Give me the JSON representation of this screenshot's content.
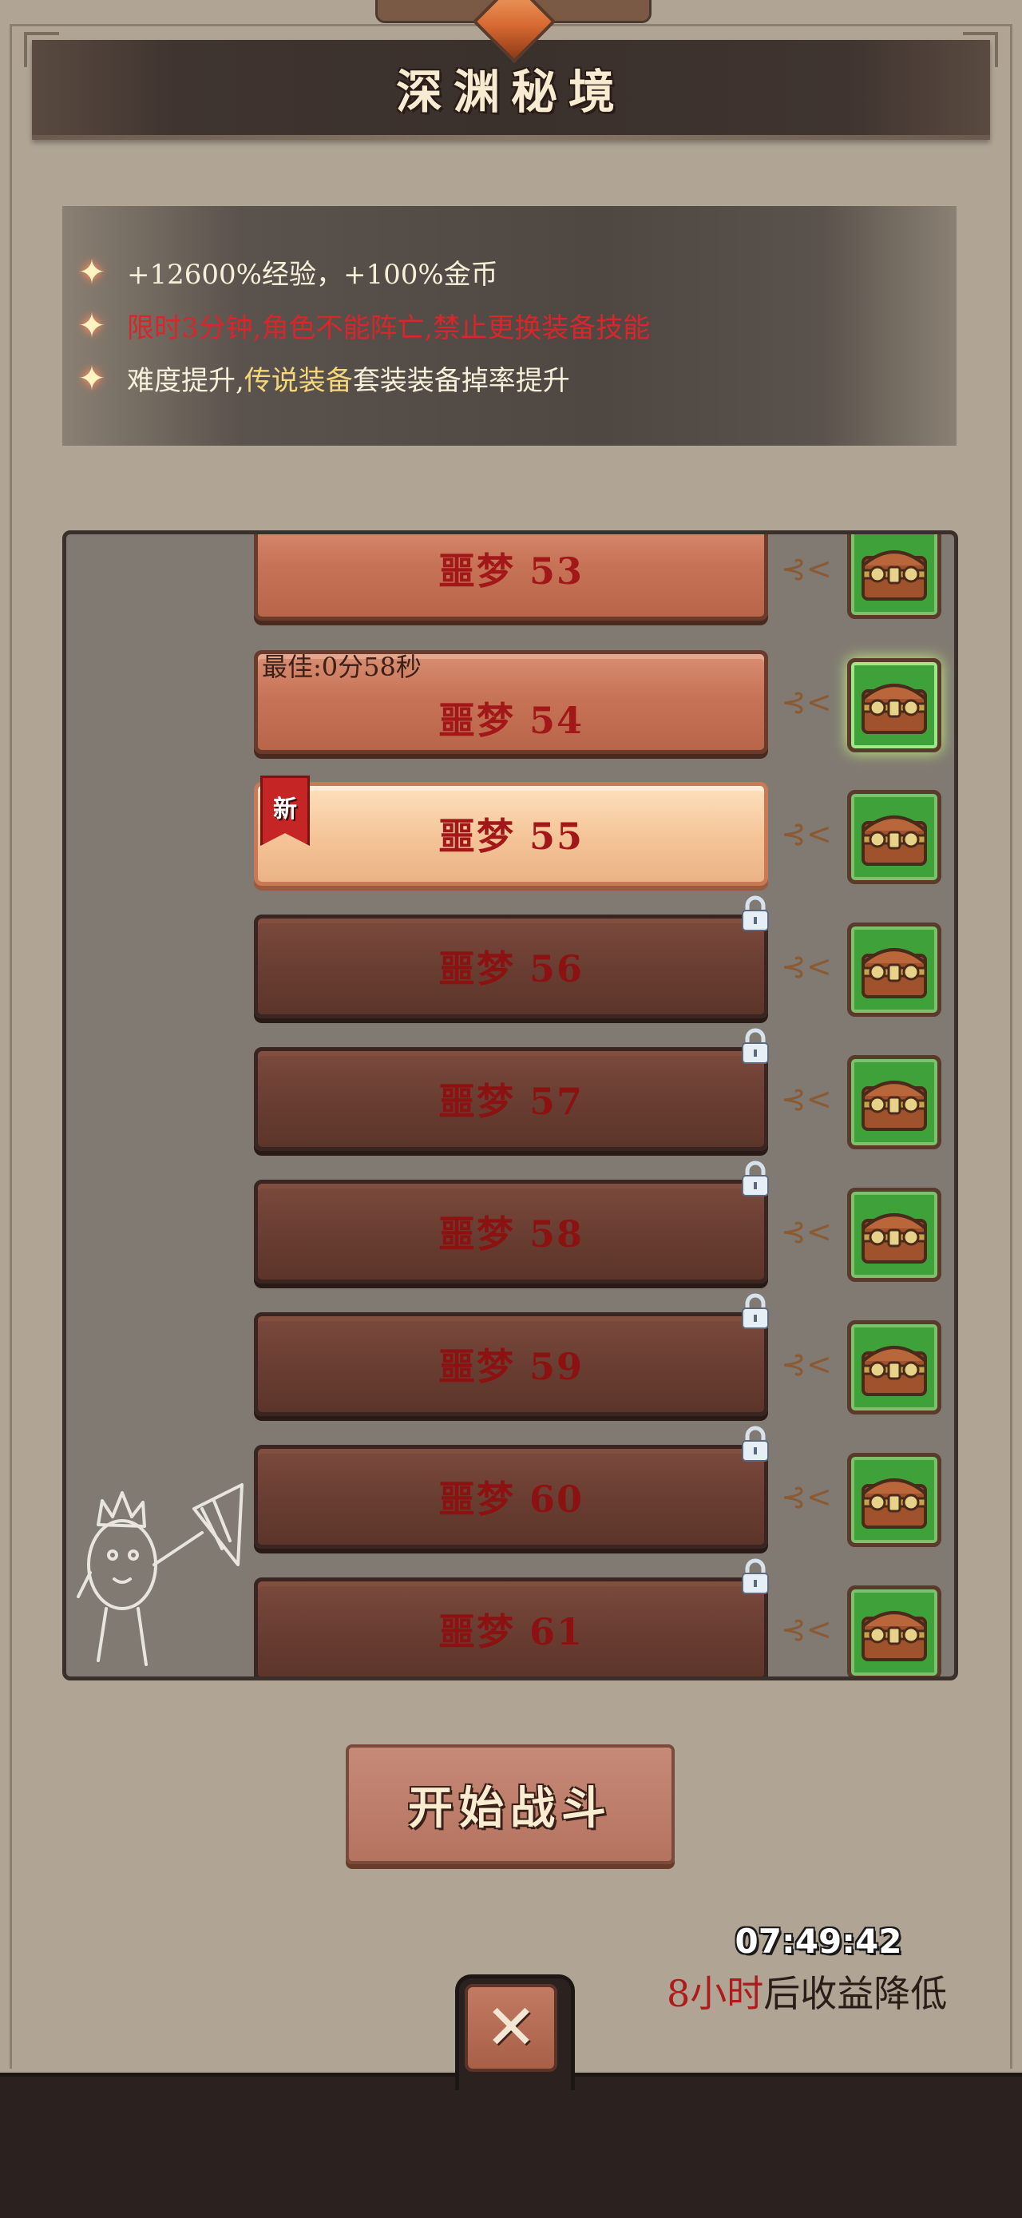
{
  "header": {
    "title": "深渊秘境"
  },
  "info": {
    "line1": "+12600%经验，+100%金币",
    "line2": "限时3分钟,角色不能阵亡,禁止更换装备技能",
    "line3_part1": "难度提升,",
    "line3_part2": "传说装备",
    "line3_part3": " 套装装备",
    "line3_part4": "掉率提升"
  },
  "levels": [
    {
      "label": "噩梦 53",
      "state": "unlocked"
    },
    {
      "label": "噩梦 54",
      "state": "unlocked",
      "best_time": "最佳:0分58秒"
    },
    {
      "label": "噩梦 55",
      "state": "current",
      "badge": "新"
    },
    {
      "label": "噩梦 56",
      "state": "locked"
    },
    {
      "label": "噩梦 57",
      "state": "locked"
    },
    {
      "label": "噩梦 58",
      "state": "locked"
    },
    {
      "label": "噩梦 59",
      "state": "locked"
    },
    {
      "label": "噩梦 60",
      "state": "locked"
    },
    {
      "label": "噩梦 61",
      "state": "locked"
    }
  ],
  "actions": {
    "start_label": "开始战斗",
    "close_symbol": "✕"
  },
  "footer": {
    "timer": "07:49:42",
    "decay_hours": "8小时",
    "decay_text": "后收益降低"
  },
  "icons": {
    "star": "star-icon",
    "lock": "lock-icon",
    "chest": "treasure-chest-icon",
    "connector": "arrow-connector-icon",
    "close": "close-icon"
  },
  "colors": {
    "accent_red": "#b11a1a",
    "gold_text": "#f3d77a",
    "chest_green": "#3fa13a"
  }
}
